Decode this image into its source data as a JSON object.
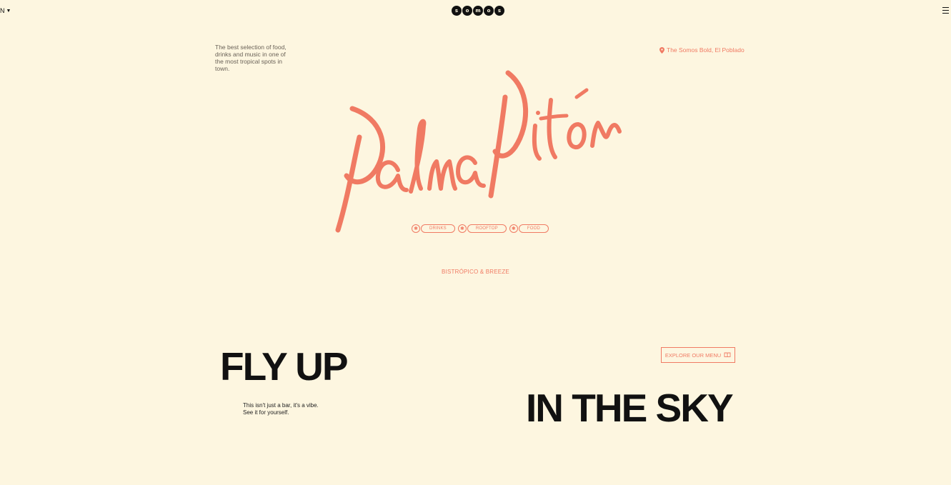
{
  "header": {
    "language": "N",
    "brand_letters": [
      "s",
      "o",
      "m",
      "o",
      "s"
    ]
  },
  "hero": {
    "tagline": "The best selection of food, drinks and music in one of the most tropical spots in town.",
    "location": "The Somos Bold, El Poblado",
    "logo_text": "Palma Pitón",
    "tags": [
      "DRINKS",
      "ROOFTOP",
      "FOOD"
    ],
    "subtitle": "BISTRÓPICO & BREEZE"
  },
  "section": {
    "heading_left": "FLY UP",
    "heading_right": "IN THE SKY",
    "vibe_line1": "This isn't just a bar, it's a vibe.",
    "vibe_line2": "See it for yourself.",
    "menu_button": "EXPLORE OUR MENU"
  },
  "colors": {
    "background": "#fdf6e0",
    "accent": "#f07a63",
    "text": "#111111"
  },
  "icons": {
    "language_caret": "caret-down-icon",
    "menu": "hamburger-menu-icon",
    "location": "map-pin-icon",
    "tag_dot": "sun-icon",
    "menu_book": "book-icon"
  }
}
